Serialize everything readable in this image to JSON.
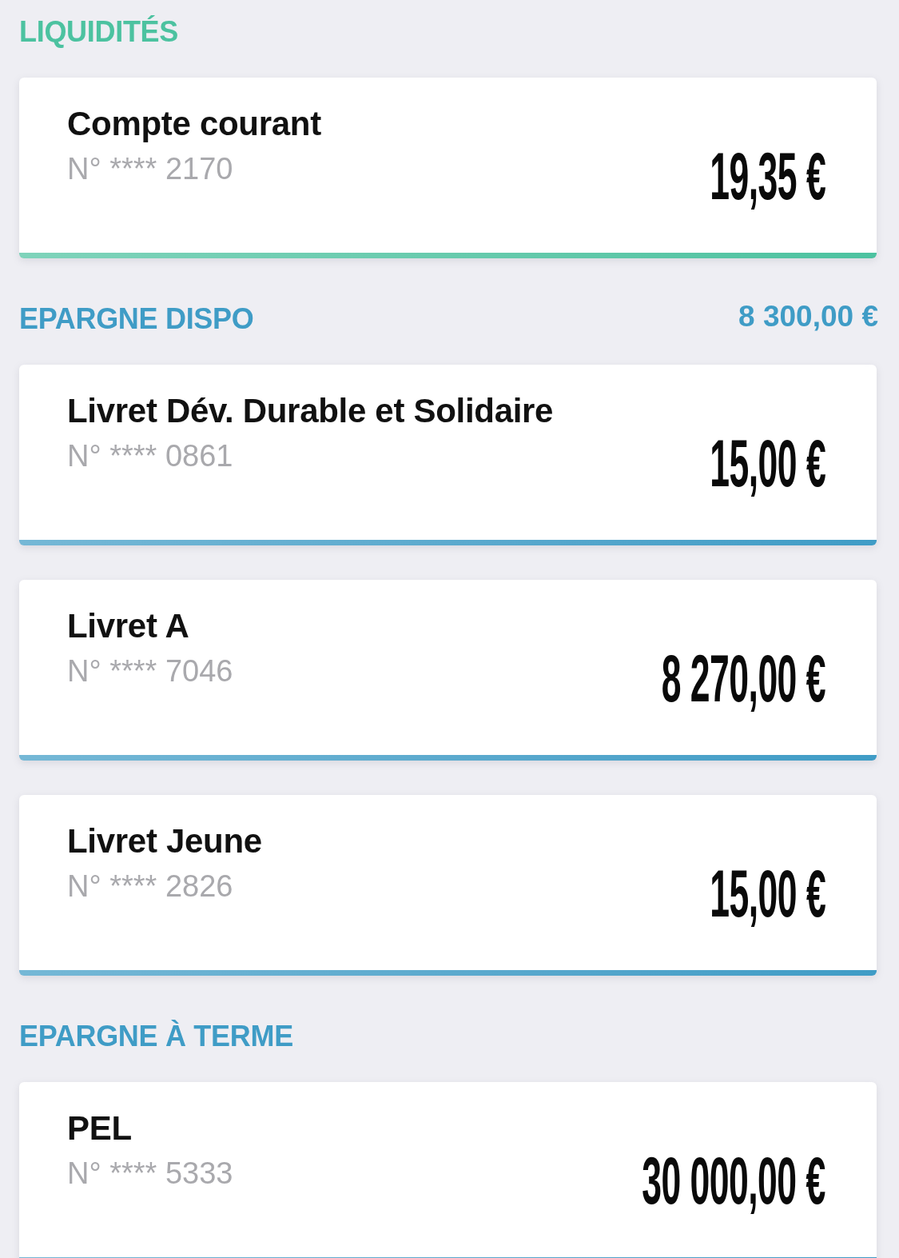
{
  "sections": [
    {
      "title": "LIQUIDITÉS",
      "color": "#4cc2a0",
      "accounts": [
        {
          "name": "Compte courant",
          "number": "N° **** 2170",
          "amount": "19,35 €"
        }
      ]
    },
    {
      "title": "EPARGNE DISPO",
      "color": "#3f9cc6",
      "total": "8 300,00 €",
      "accounts": [
        {
          "name": "Livret Dév. Durable et Solidaire",
          "number": "N° **** 0861",
          "amount": "15,00 €"
        },
        {
          "name": "Livret A",
          "number": "N° **** 7046",
          "amount": "8 270,00 €"
        },
        {
          "name": "Livret Jeune",
          "number": "N° **** 2826",
          "amount": "15,00 €"
        }
      ]
    },
    {
      "title": "EPARGNE À TERME",
      "color": "#3f9cc6",
      "accounts": [
        {
          "name": "PEL",
          "number": "N° **** 5333",
          "amount": "30 000,00 €"
        }
      ]
    }
  ]
}
